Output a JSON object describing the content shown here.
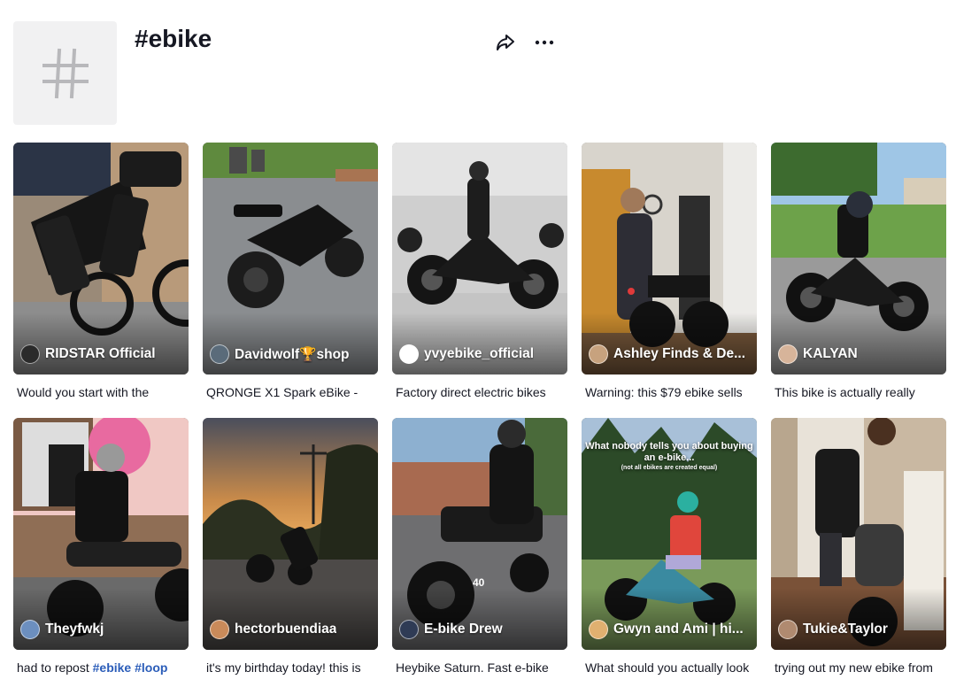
{
  "header": {
    "title": "#ebike",
    "avatar_icon": "hashtag-icon",
    "share_icon": "share-icon",
    "more_icon": "more-icon"
  },
  "videos": [
    {
      "author": "RIDSTAR Official",
      "caption": "Would you start with the",
      "avatar_color": "#2a2a2a"
    },
    {
      "author": "Davidwolf🏆shop",
      "caption": "QRONGE X1 Spark eBike -",
      "avatar_color": "#5a6b7a"
    },
    {
      "author": "yvyebike_official",
      "caption": "Factory direct electric bikes",
      "avatar_color": "#ffffff"
    },
    {
      "author": "Ashley Finds & De...",
      "caption": "Warning: this $79 ebike sells",
      "avatar_color": "#c7a27e"
    },
    {
      "author": "KALYAN",
      "caption": "This bike is actually really",
      "avatar_color": "#d7b49a"
    },
    {
      "author": "Theyfwkj",
      "caption_text": "had to repost ",
      "caption_tags": [
        "#ebike",
        "#loop"
      ],
      "avatar_color": "#6c8fbf"
    },
    {
      "author": "hectorbuendiaa",
      "caption": "it's my birthday today! this is",
      "avatar_color": "#c98a5a"
    },
    {
      "author": "E-bike Drew",
      "caption": "Heybike Saturn. Fast e-bike",
      "avatar_color": "#2f3b55"
    },
    {
      "author": "Gwyn and Ami | hi...",
      "caption": "What should you actually look",
      "avatar_color": "#e0b070",
      "overlay": "What nobody tells you about buying an e-bike...",
      "overlay_small": "(not all ebikes are created equal)"
    },
    {
      "author": "Tukie&Taylor",
      "caption": "trying out my new ebike from",
      "avatar_color": "#b08a70"
    }
  ],
  "speed_readout": "40"
}
